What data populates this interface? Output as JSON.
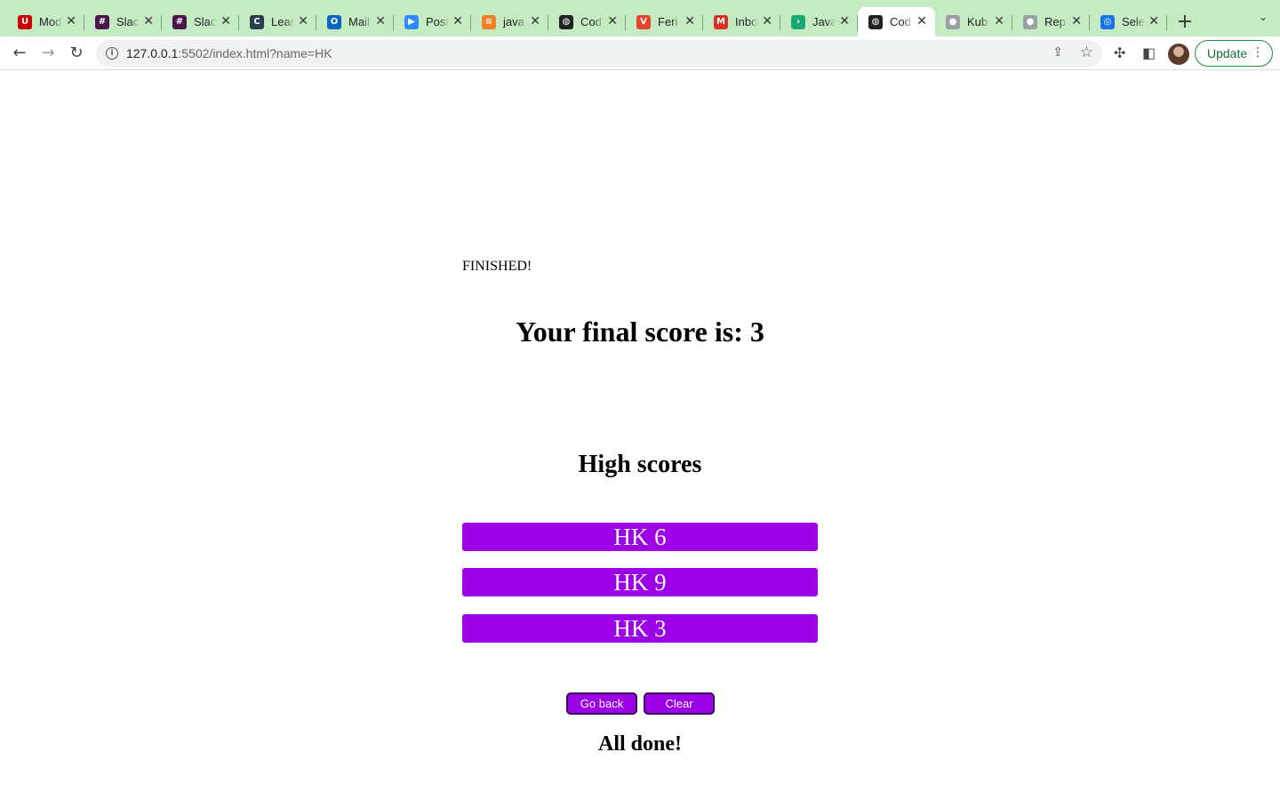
{
  "browser": {
    "tabs": [
      {
        "title": "Mod",
        "icon": "utah-u-icon",
        "color": "#cc0000",
        "glyph": "U"
      },
      {
        "title": "Slac",
        "icon": "slack-icon",
        "color": "#4a154b",
        "glyph": "#"
      },
      {
        "title": "Slac",
        "icon": "slack-icon",
        "color": "#4a154b",
        "glyph": "#"
      },
      {
        "title": "Lear",
        "icon": "learn-icon",
        "color": "#2d3e50",
        "glyph": "C"
      },
      {
        "title": "Mail",
        "icon": "outlook-icon",
        "color": "#0a64c2",
        "glyph": "O"
      },
      {
        "title": "Post",
        "icon": "zoom-icon",
        "color": "#2d8cff",
        "glyph": "▶"
      },
      {
        "title": "java",
        "icon": "stackoverflow-icon",
        "color": "#f48024",
        "glyph": "≡"
      },
      {
        "title": "Cod",
        "icon": "globe-icon",
        "color": "#222222",
        "glyph": "◍"
      },
      {
        "title": "Feri",
        "icon": "brave-shield-icon",
        "color": "#e8412c",
        "glyph": "V"
      },
      {
        "title": "Inbo",
        "icon": "gmail-icon",
        "color": "#d93025",
        "glyph": "M"
      },
      {
        "title": "Java",
        "icon": "play-arrow-icon",
        "color": "#19a974",
        "glyph": "›"
      },
      {
        "title": "Cod",
        "icon": "globe-icon",
        "color": "#222222",
        "glyph": "◍",
        "active": true
      },
      {
        "title": "Kub",
        "icon": "github-icon",
        "color": "#9aa0a6",
        "glyph": "●"
      },
      {
        "title": "Rep",
        "icon": "github-icon",
        "color": "#9aa0a6",
        "glyph": "●"
      },
      {
        "title": "Sele",
        "icon": "circle-logo-icon",
        "color": "#1a73e8",
        "glyph": "◎"
      }
    ],
    "url_host": "127.0.0.1",
    "url_path": ":5502/index.html?name=HK",
    "update_label": "Update"
  },
  "page": {
    "finished_text": "FINISHED!",
    "final_score_text": "Your final score is: 3",
    "high_scores_title": "High scores",
    "high_scores": [
      "HK 6",
      "HK 9",
      "HK 3"
    ],
    "go_back_label": "Go back",
    "clear_label": "Clear",
    "all_done_text": "All done!"
  },
  "colors": {
    "accent": "#9b00e6",
    "tabstrip": "#c4ebc1"
  }
}
